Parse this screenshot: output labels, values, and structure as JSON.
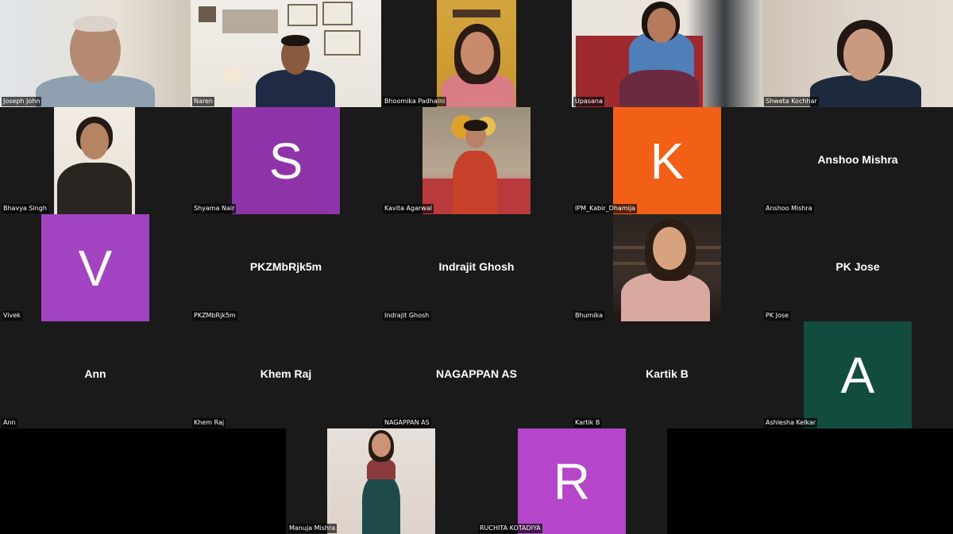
{
  "meeting": {
    "participants": [
      {
        "name": "Joseph John"
      },
      {
        "name": "Naren"
      },
      {
        "name": "Bhoomika Padhalni"
      },
      {
        "name": "Upasana"
      },
      {
        "name": "Shweta Kochhar"
      },
      {
        "name": "Bhavya Singh"
      },
      {
        "name": "Shyama Nair",
        "initial": "S",
        "color": "#8e33a8"
      },
      {
        "name": "Kavita Agarwal"
      },
      {
        "name": "IPM_Kabir_Dhamija",
        "initial": "K",
        "color": "#f25f16"
      },
      {
        "name": "Anshoo Mishra",
        "display": "Anshoo Mishra"
      },
      {
        "name": "Vivek",
        "initial": "V",
        "color": "#a244c1"
      },
      {
        "name": "PKZMbRjk5m",
        "display": "PKZMbRjk5m"
      },
      {
        "name": "Indrajit Ghosh",
        "display": "Indrajit Ghosh"
      },
      {
        "name": "Bhumika"
      },
      {
        "name": "PK Jose",
        "display": "PK Jose"
      },
      {
        "name": "Ann",
        "display": "Ann"
      },
      {
        "name": "Khem Raj",
        "display": "Khem Raj"
      },
      {
        "name": "NAGAPPAN AS",
        "display": "NAGAPPAN AS"
      },
      {
        "name": "Kartik B",
        "display": "Kartik B"
      },
      {
        "name": "Ashlesha Kelkar",
        "initial": "A",
        "color": "#124c3e"
      },
      {
        "name": "Manuja Mishra"
      },
      {
        "name": "RUCHITA KOTADIYA",
        "initial": "R",
        "color": "#b546c9"
      }
    ]
  }
}
